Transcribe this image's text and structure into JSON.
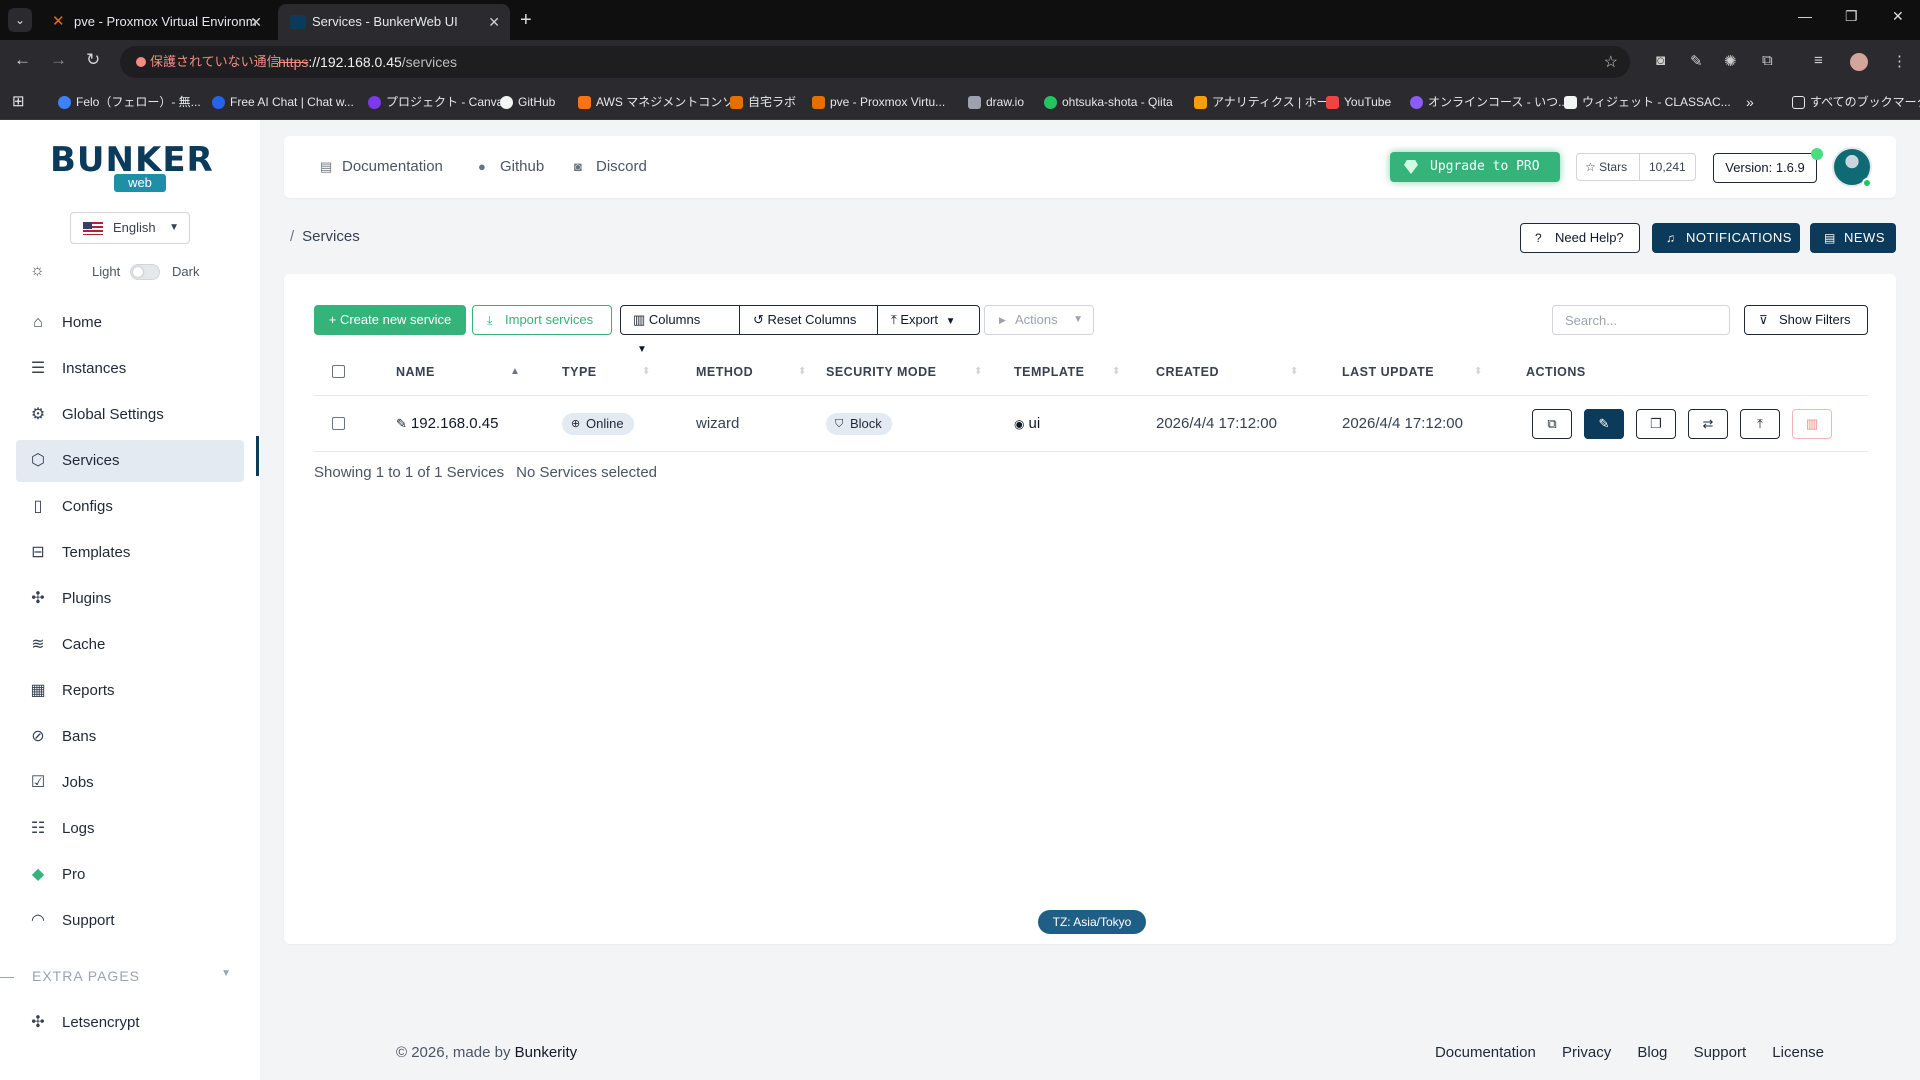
{
  "browser": {
    "tabs": [
      {
        "title": "pve - Proxmox Virtual Environm"
      },
      {
        "title": "Services - BunkerWeb UI"
      }
    ],
    "security_warning": "保護されていない通信",
    "url_protocol": "https",
    "url_host": "://192.168.0.45",
    "url_path": "/services",
    "bookmarks": [
      "Felo（フェロー）- 無...",
      "Free AI Chat | Chat w...",
      "プロジェクト - Canva",
      "GitHub",
      "AWS マネジメントコンソ...",
      "自宅ラボ",
      "pve - Proxmox Virtu...",
      "draw.io",
      "ohtsuka-shota - Qiita",
      "アナリティクス | ホーム",
      "YouTube",
      "オンラインコース - いつ...",
      "ウィジェット - CLASSAC...",
      "すべてのブックマーク"
    ]
  },
  "sidebar": {
    "logo_word": "BUNKER",
    "logo_sub": "web",
    "language": "English",
    "theme_light": "Light",
    "theme_dark": "Dark",
    "items": [
      {
        "label": "Home",
        "icon": "home-icon"
      },
      {
        "label": "Instances",
        "icon": "server-icon"
      },
      {
        "label": "Global Settings",
        "icon": "gear-icon"
      },
      {
        "label": "Services",
        "icon": "box-icon"
      },
      {
        "label": "Configs",
        "icon": "file-icon"
      },
      {
        "label": "Templates",
        "icon": "template-icon"
      },
      {
        "label": "Plugins",
        "icon": "puzzle-icon"
      },
      {
        "label": "Cache",
        "icon": "database-icon"
      },
      {
        "label": "Reports",
        "icon": "reports-icon"
      },
      {
        "label": "Bans",
        "icon": "ban-icon"
      },
      {
        "label": "Jobs",
        "icon": "checklist-icon"
      },
      {
        "label": "Logs",
        "icon": "logs-icon"
      },
      {
        "label": "Pro",
        "icon": "diamond-icon"
      },
      {
        "label": "Support",
        "icon": "headset-icon"
      }
    ],
    "extra_pages_label": "EXTRA PAGES",
    "extra_items": [
      {
        "label": "Letsencrypt",
        "icon": "puzzle-icon"
      }
    ]
  },
  "header": {
    "links": [
      "Documentation",
      "Github",
      "Discord"
    ],
    "upgrade": "Upgrade to PRO",
    "stars_label": "Stars",
    "stars_count": "10,241",
    "version": "Version: 1.6.9"
  },
  "page": {
    "breadcrumb": "Services",
    "need_help": "Need Help?",
    "notifications": "NOTIFICATIONS",
    "news": "NEWS"
  },
  "toolbar": {
    "create": "+ Create new service",
    "import": "Import services",
    "columns": "Columns",
    "reset_columns": "Reset Columns",
    "export": "Export",
    "actions": "Actions",
    "search_placeholder": "Search...",
    "show_filters": "Show Filters"
  },
  "table": {
    "headers": [
      "NAME",
      "TYPE",
      "METHOD",
      "SECURITY MODE",
      "TEMPLATE",
      "CREATED",
      "LAST UPDATE",
      "ACTIONS"
    ],
    "rows": [
      {
        "name": "192.168.0.45",
        "type": "Online",
        "method": "wizard",
        "security_mode": "Block",
        "template": "ui",
        "created": "2026/4/4 17:12:00",
        "last_update": "2026/4/4 17:12:00"
      }
    ],
    "showing": "Showing 1 to 1 of 1 Services",
    "selected": "No Services selected"
  },
  "timezone": "TZ: Asia/Tokyo",
  "footer": {
    "copyright": "© 2026, made by",
    "brand": "Bunkerity",
    "links": [
      "Documentation",
      "Privacy",
      "Blog",
      "Support",
      "License"
    ]
  }
}
